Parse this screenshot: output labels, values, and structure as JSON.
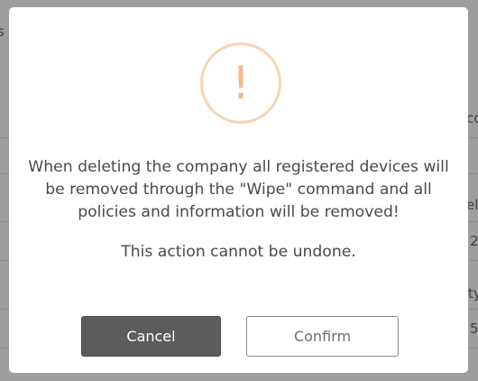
{
  "background": {
    "fragments": [
      "s",
      "co",
      "ele",
      "2",
      "ty",
      "5"
    ]
  },
  "dialog": {
    "icon": "alert-exclamation-icon",
    "icon_glyph": "!",
    "message": "When deleting the company all registered devices will be removed through the \"Wipe\" command and all policies and information will be removed!",
    "note": "This action cannot be undone.",
    "cancel_label": "Cancel",
    "confirm_label": "Confirm"
  },
  "colors": {
    "overlay": "#9e9e9e",
    "icon_ring": "#f8d4b4",
    "icon_glyph": "#f5b989",
    "cancel_bg": "#5c5c5c"
  }
}
